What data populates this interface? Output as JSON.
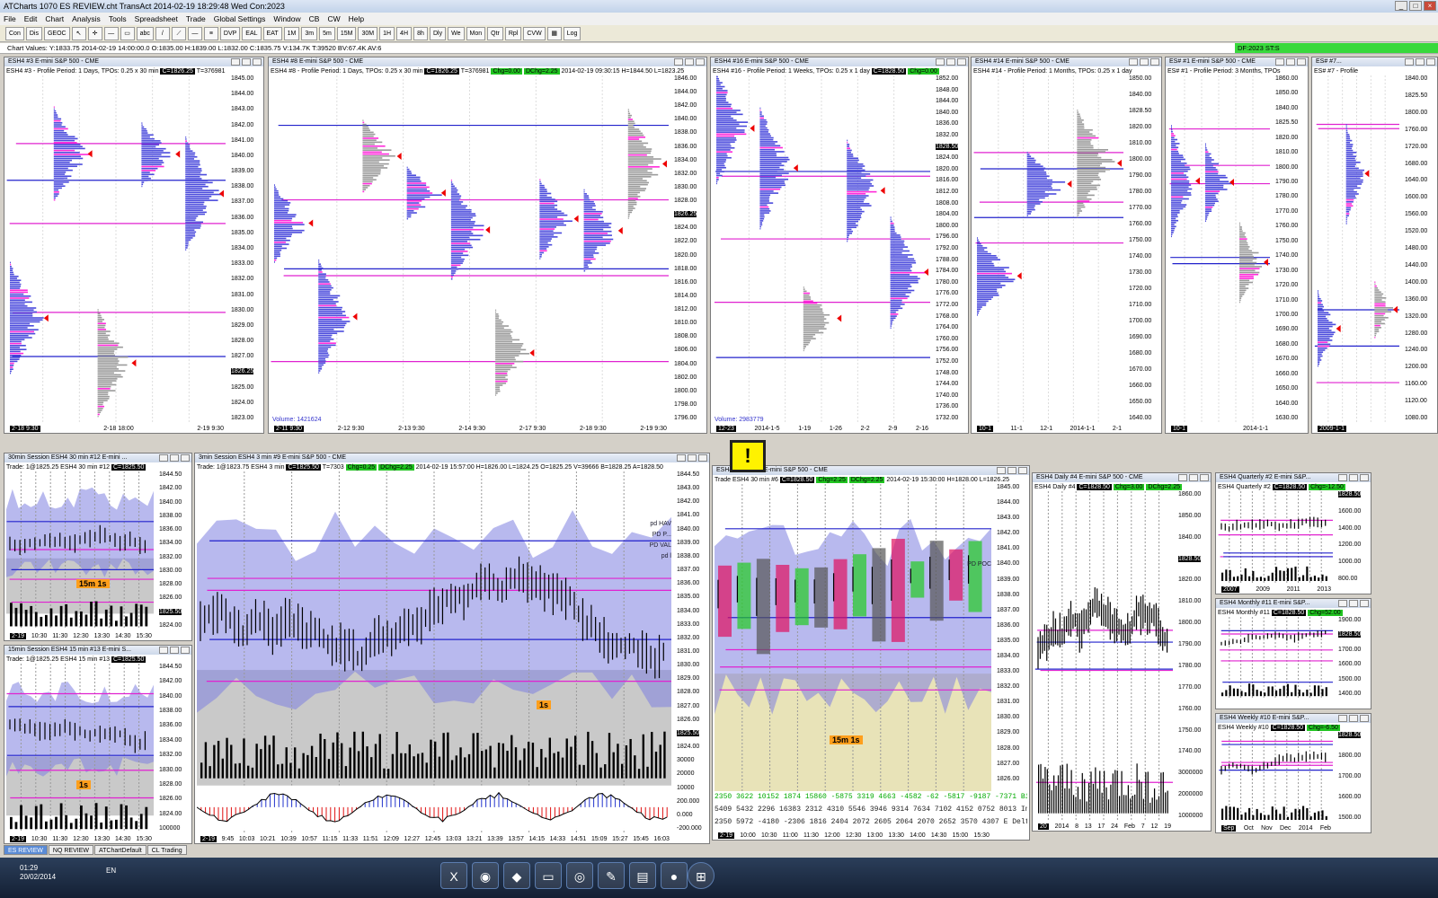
{
  "app": {
    "title": "ATCharts 1070 ES REVIEW.cht  TransAct 2014-02-19  18:29:48 Wed  Con:2023"
  },
  "menu": [
    "File",
    "Edit",
    "Chart",
    "Analysis",
    "Tools",
    "Spreadsheet",
    "Trade",
    "Global Settings",
    "Window",
    "CB",
    "CW",
    "Help"
  ],
  "toolbar": [
    "Con",
    "Dis",
    "GEOC",
    "DVP",
    "EAL",
    "EAT",
    "1M",
    "3m",
    "5m",
    "15M",
    "30M",
    "1H",
    "4H",
    "8h",
    "Dly",
    "We",
    "Mon",
    "Qtr",
    "Rpl",
    "CVW",
    "Log"
  ],
  "chart_values": "Chart Values: Y:1833.75  2014-02-19  14:00:00.0  O:1835.00  H:1839.00  L:1832.00  C:1835.75  V:134.7K  T:39520  BV:67.4K  AV:6",
  "status_badge": "DF:2023  ST:S",
  "panels": [
    {
      "id": "p3",
      "title": "ESH4  #3  E-mini S&P 500 - CME",
      "info": "ESH4  #3 - Profile Period: 1 Days, TPOs: 0.25 x 30 min",
      "c": "C=1826.25",
      "t": "T=376981",
      "axis": [
        "1845.00",
        "1844.00",
        "1843.00",
        "1842.00",
        "1841.00",
        "1840.00",
        "1839.00",
        "1838.00",
        "1837.00",
        "1836.00",
        "1835.00",
        "1834.00",
        "1833.00",
        "1832.00",
        "1831.00",
        "1830.00",
        "1829.00",
        "1828.00",
        "1827.00",
        "1826.25",
        "1825.00",
        "1824.00",
        "1823.00"
      ],
      "x": [
        "2-18  9:30",
        "2-18  18:00",
        "2-19  9:30"
      ]
    },
    {
      "id": "p8",
      "title": "ESH4  #8  E-mini S&P 500 - CME",
      "info": "ESH4  #8 - Profile Period: 1 Days, TPOs: 0.25 x 30 min",
      "c": "C=1826.25",
      "t": "T=376981",
      "chg": "Chg=0.00",
      "dchg": "DChg=2.25",
      "ohlc": "2014-02-19  09:30:15  H=1844.50  L=1823.25",
      "vol": "Volume: 1421624",
      "axis": [
        "1846.00",
        "1844.00",
        "1842.00",
        "1840.00",
        "1838.00",
        "1836.00",
        "1834.00",
        "1832.00",
        "1830.00",
        "1828.00",
        "1826.25",
        "1824.00",
        "1822.00",
        "1820.00",
        "1818.00",
        "1816.00",
        "1814.00",
        "1812.00",
        "1810.00",
        "1808.00",
        "1806.00",
        "1804.00",
        "1802.00",
        "1800.00",
        "1798.00",
        "1796.00"
      ],
      "x": [
        "2-11  9:30",
        "2-12  9:30",
        "2-13  9:30",
        "2-14  9:30",
        "2-17  9:30",
        "2-18  9:30",
        "2-19  9:30"
      ]
    },
    {
      "id": "p16",
      "title": "ESH4  #16  E-mini S&P 500 - CME",
      "info": "ESH4  #16 - Profile Period: 1 Weeks, TPOs: 0.25 x 1 day",
      "c": "C=1828.50",
      "chg": "Chg=0.00",
      "vol": "Volume: 2983779",
      "axis": [
        "1852.00",
        "1848.00",
        "1844.00",
        "1840.00",
        "1836.00",
        "1832.00",
        "1828.50",
        "1824.00",
        "1820.00",
        "1816.00",
        "1812.00",
        "1808.00",
        "1804.00",
        "1800.00",
        "1796.00",
        "1792.00",
        "1788.00",
        "1784.00",
        "1780.00",
        "1776.00",
        "1772.00",
        "1768.00",
        "1764.00",
        "1760.00",
        "1756.00",
        "1752.00",
        "1748.00",
        "1744.00",
        "1740.00",
        "1736.00",
        "1732.00"
      ],
      "x": [
        "12-23",
        "2014-1-5",
        "1-19",
        "1-26",
        "2-2",
        "2-9",
        "2-16"
      ]
    },
    {
      "id": "p14",
      "title": "ESH4  #14  E-mini S&P 500 - CME",
      "info": "ESH4  #14 - Profile Period: 1 Months, TPOs: 0.25 x 1 day",
      "axis": [
        "1850.00",
        "1840.00",
        "1828.50",
        "1820.00",
        "1810.00",
        "1800.00",
        "1790.00",
        "1780.00",
        "1770.00",
        "1760.00",
        "1750.00",
        "1740.00",
        "1730.00",
        "1720.00",
        "1710.00",
        "1700.00",
        "1690.00",
        "1680.00",
        "1670.00",
        "1660.00",
        "1650.00",
        "1640.00"
      ],
      "x": [
        "10-1",
        "11-1",
        "12-1",
        "2014-1-1",
        "2-1"
      ]
    },
    {
      "id": "p1",
      "title": "ES#  #1  E-mini S&P 500 - CME",
      "info": "ES#  #1 - Profile Period: 3 Months, TPOs",
      "axis": [
        "1860.00",
        "1850.00",
        "1840.00",
        "1825.50",
        "1820.00",
        "1810.00",
        "1800.00",
        "1790.00",
        "1780.00",
        "1770.00",
        "1760.00",
        "1750.00",
        "1740.00",
        "1730.00",
        "1720.00",
        "1710.00",
        "1700.00",
        "1690.00",
        "1680.00",
        "1670.00",
        "1660.00",
        "1650.00",
        "1640.00",
        "1630.00"
      ],
      "x": [
        "10-1",
        "2014-1-1"
      ]
    },
    {
      "id": "p7",
      "title": "ES#  #7...",
      "info": "ES#  #7 - Profile",
      "axis": [
        "1840.00",
        "1825.50",
        "1800.00",
        "1760.00",
        "1720.00",
        "1680.00",
        "1640.00",
        "1600.00",
        "1560.00",
        "1520.00",
        "1480.00",
        "1440.00",
        "1400.00",
        "1360.00",
        "1320.00",
        "1280.00",
        "1240.00",
        "1200.00",
        "1160.00",
        "1120.00",
        "1080.00"
      ],
      "x": [
        "2009-1-1"
      ]
    },
    {
      "id": "p12",
      "title": "30min Session  ESH4  30 min  #12  E-mini ...",
      "info": "Trade: 1@1825.25  ESH4  30 min  #12",
      "c": "C=1825.50",
      "badge": "15m 1s",
      "axis": [
        "1844.50",
        "1842.00",
        "1840.00",
        "1838.00",
        "1836.00",
        "1834.00",
        "1832.00",
        "1830.00",
        "1828.00",
        "1826.00",
        "1825.50",
        "1824.00"
      ],
      "x": [
        "2-19",
        "10:30",
        "11:30",
        "12:30",
        "13:30",
        "14:30",
        "15:30"
      ]
    },
    {
      "id": "p13",
      "title": "15min Session  ESH4  15 min  #13  E-mini S...",
      "info": "Trade: 1@1825.25  ESH4  15 min  #13",
      "c": "C=1825.50",
      "badge": "1s",
      "axis": [
        "1844.50",
        "1842.00",
        "1840.00",
        "1838.00",
        "1836.00",
        "1834.00",
        "1832.00",
        "1830.00",
        "1828.00",
        "1826.00",
        "1824.00",
        "100000"
      ],
      "x": [
        "2-19",
        "10:30",
        "11:30",
        "12:30",
        "13:30",
        "14:30",
        "15:30"
      ]
    },
    {
      "id": "p9",
      "title": "3min Session  ESH4  3 min  #9  E-mini S&P 500 - CME",
      "info": "Trade: 1@1823.75  ESH4  3 min",
      "c": "C=1825.50",
      "t": "T=7303",
      "chg": "Chg=0.25",
      "dchg": "DChg=2.25",
      "ohlc": "2014-02-19  15:57:00  H=1826.00  L=1824.25  O=1825.25  V=39666  B=1828.25  A=1828.50",
      "badge": "1s",
      "labels": [
        "pd HAV",
        "PD P...",
        "PD VAL",
        "pd l"
      ],
      "axis": [
        "1844.50",
        "1843.00",
        "1842.00",
        "1841.00",
        "1840.00",
        "1839.00",
        "1838.00",
        "1837.00",
        "1836.00",
        "1835.00",
        "1834.00",
        "1833.00",
        "1832.00",
        "1831.00",
        "1830.00",
        "1829.00",
        "1828.00",
        "1827.00",
        "1826.00",
        "1825.50",
        "1824.00",
        "30000",
        "20000",
        "10000",
        "200.000",
        "0.000",
        "-200.000"
      ],
      "x": [
        "2-19",
        "9:45",
        "10:03",
        "10:21",
        "10:39",
        "10:57",
        "11:15",
        "11:33",
        "11:51",
        "12:09",
        "12:27",
        "12:45",
        "13:03",
        "13:21",
        "13:39",
        "13:57",
        "14:15",
        "14:33",
        "14:51",
        "15:09",
        "15:27",
        "15:45",
        "16:03"
      ]
    },
    {
      "id": "p6",
      "title": "ESH4  30 min  #6  E-mini S&P 500 - CME",
      "info": "Trade  ESH4  30 min  #6",
      "c": "C=1828.50",
      "chg": "Chg=2.25",
      "dchg": "DChg=2.25",
      "ohlc": "2014-02-19  15:30:00  H=1828.00  L=1826.25",
      "badge": "15m 1s",
      "poc": "PD POC",
      "axis": [
        "1845.00",
        "1844.00",
        "1843.00",
        "1842.00",
        "1841.00",
        "1840.00",
        "1839.00",
        "1838.00",
        "1837.00",
        "1836.00",
        "1835.00",
        "1834.00",
        "1833.00",
        "1832.00",
        "1831.00",
        "1830.00",
        "1829.00",
        "1828.00",
        "1827.00",
        "1826.00",
        "1825.00",
        "1824.00",
        "1823.00"
      ],
      "rows": [
        "2350  3622  10152  1874  15860  -5875  3319  4663  -4582  -62  -5817  -9187  -7371  BidV",
        "5409  5432  2296  16383  2312  4310  5546  3946  9314  7634  7102  4152  0752  8013  In Vol",
        "2350  5972  -4180  -2306  1816  2404  2072  2605  2064  2070  2652  3570  4307  E Delta"
      ],
      "x": [
        "2-19",
        "10:00",
        "10:30",
        "11:00",
        "11:30",
        "12:00",
        "12:30",
        "13:00",
        "13:30",
        "14:00",
        "14:30",
        "15:00",
        "15:30"
      ]
    },
    {
      "id": "p4",
      "title": "ESH4  Daily  #4  E-mini S&P 500 - CME",
      "info": "ESH4  Daily  #4",
      "c": "C=1828.50",
      "chg": "Chg=3.00",
      "dchg": "DChg=2.25",
      "axis": [
        "1860.00",
        "1850.00",
        "1840.00",
        "1828.50",
        "1820.00",
        "1810.00",
        "1800.00",
        "1790.00",
        "1780.00",
        "1770.00",
        "1760.00",
        "1750.00",
        "1740.00",
        "3000000",
        "2000000",
        "1000000"
      ],
      "x": [
        "20",
        "2014",
        "8",
        "13",
        "17",
        "24",
        "Feb",
        "7",
        "12",
        "19"
      ]
    },
    {
      "id": "p2",
      "title": "ESH4  Quarterly  #2  E-mini S&P...",
      "info": "ESH4  Quarterly  #2",
      "c": "C=1828.50",
      "chg": "Chg=-12.50",
      "axis": [
        "1828.50",
        "1600.00",
        "1400.00",
        "1200.00",
        "1000.00",
        "800.00"
      ],
      "x": [
        "2007",
        "2009",
        "2011",
        "2013"
      ]
    },
    {
      "id": "p11",
      "title": "ESH4  Monthly  #11  E-mini S&P...",
      "info": "ESH4  Monthly  #11",
      "c": "C=1828.50",
      "chg": "Chg=52.00",
      "axis": [
        "1900.00",
        "1828.50",
        "1700.00",
        "1600.00",
        "1500.00",
        "1400.00"
      ],
      "x": [
        ""
      ]
    },
    {
      "id": "p10",
      "title": "ESH4  Weekly  #10  E-mini S&P...",
      "info": "ESH4  Weekly  #10",
      "c": "C=1828.50",
      "chg": "Chg=-6.50",
      "axis": [
        "1828.50",
        "1800.00",
        "1700.00",
        "1600.00",
        "1500.00"
      ],
      "x": [
        "Sep",
        "Oct",
        "Nov",
        "Dec",
        "2014",
        "Feb"
      ]
    }
  ],
  "tabs": [
    "ES REVIEW",
    "NQ REVIEW",
    "ATChartDefault",
    "CL Trading"
  ],
  "clock": {
    "time": "01:29",
    "date": "20/02/2014",
    "lang": "EN"
  }
}
